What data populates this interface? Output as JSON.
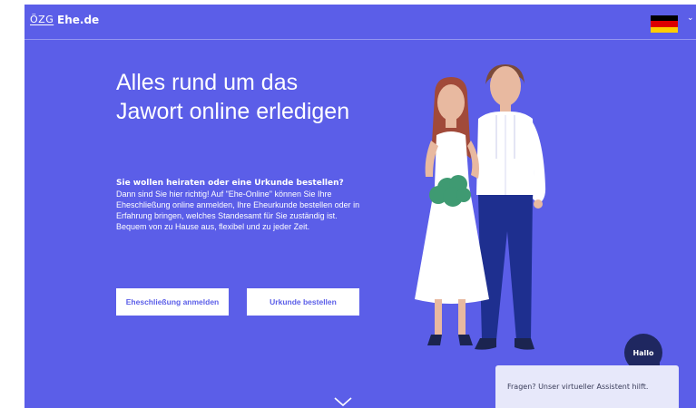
{
  "header": {
    "logo_text": "ÖZG",
    "site_name": "Ehe.de",
    "language_flag": "germany-flag-icon",
    "flag_colors": [
      "#000000",
      "#dd0000",
      "#ffce00"
    ],
    "menu_chevron": "chevron-down-icon"
  },
  "hero": {
    "title": "Alles rund um das Jawort online erledigen",
    "lead": "Sie wollen heiraten oder eine Urkunde bestellen?",
    "description": "Dann sind Sie hier richtig! Auf \"Ehe-Online\" können Sie Ihre Eheschließung online anmelden, Ihre Eheurkunde bestellen oder in Erfahrung bringen, welches Standesamt für Sie zuständig ist. Bequem von zu Hause aus, flexibel und zu jeder Zeit.",
    "buttons": {
      "register": "Eheschließung anmelden",
      "order": "Urkunde bestellen"
    },
    "scroll_icon": "chevron-down-icon"
  },
  "chat": {
    "bubble_label": "Hallo",
    "panel_text": "Fragen? Unser virtueller Assistent hilft."
  },
  "colors": {
    "primary": "#5b5ee8",
    "chat_dark": "#1f2760",
    "chat_panel": "#e7e8fa"
  }
}
